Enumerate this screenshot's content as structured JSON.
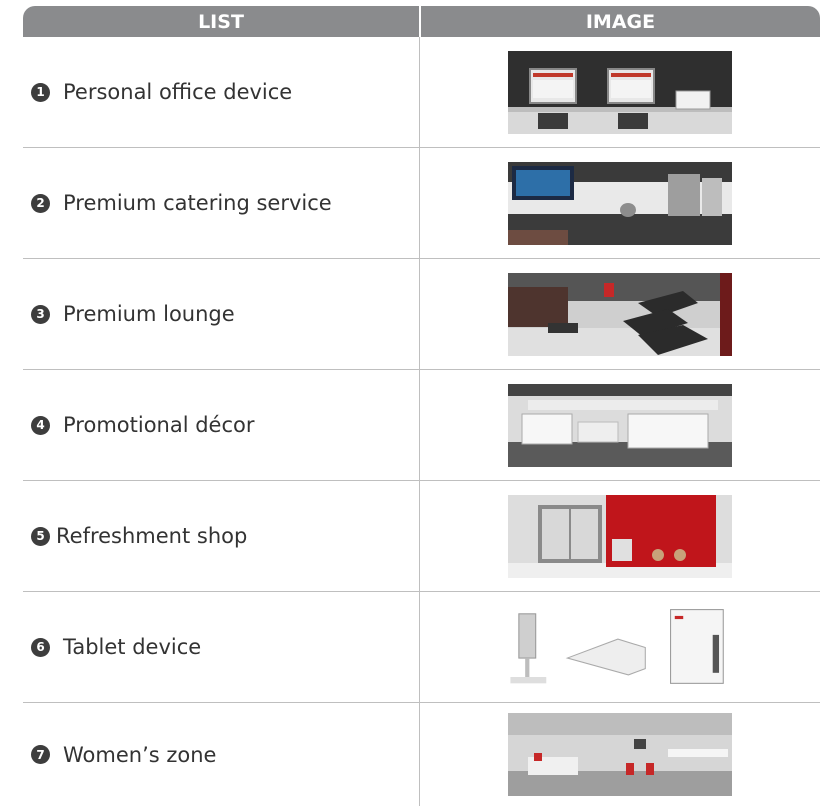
{
  "header": {
    "col1": "LIST",
    "col2": "IMAGE"
  },
  "rows": [
    {
      "num": "1",
      "label": "Personal office device",
      "image": "office-desks-with-monitors"
    },
    {
      "num": "2",
      "label": "Premium catering service",
      "image": "coffee-machine-counter"
    },
    {
      "num": "3",
      "label": "Premium lounge",
      "image": "lounge-recliners"
    },
    {
      "num": "4",
      "label": "Promotional décor",
      "image": "display-counters"
    },
    {
      "num": "5",
      "label": "Refreshment shop",
      "image": "red-wall-shop"
    },
    {
      "num": "6",
      "label": "Tablet device",
      "image": "tablet-stands-and-charger"
    },
    {
      "num": "7",
      "label": "Women’s zone",
      "image": "white-lounge-room"
    }
  ]
}
